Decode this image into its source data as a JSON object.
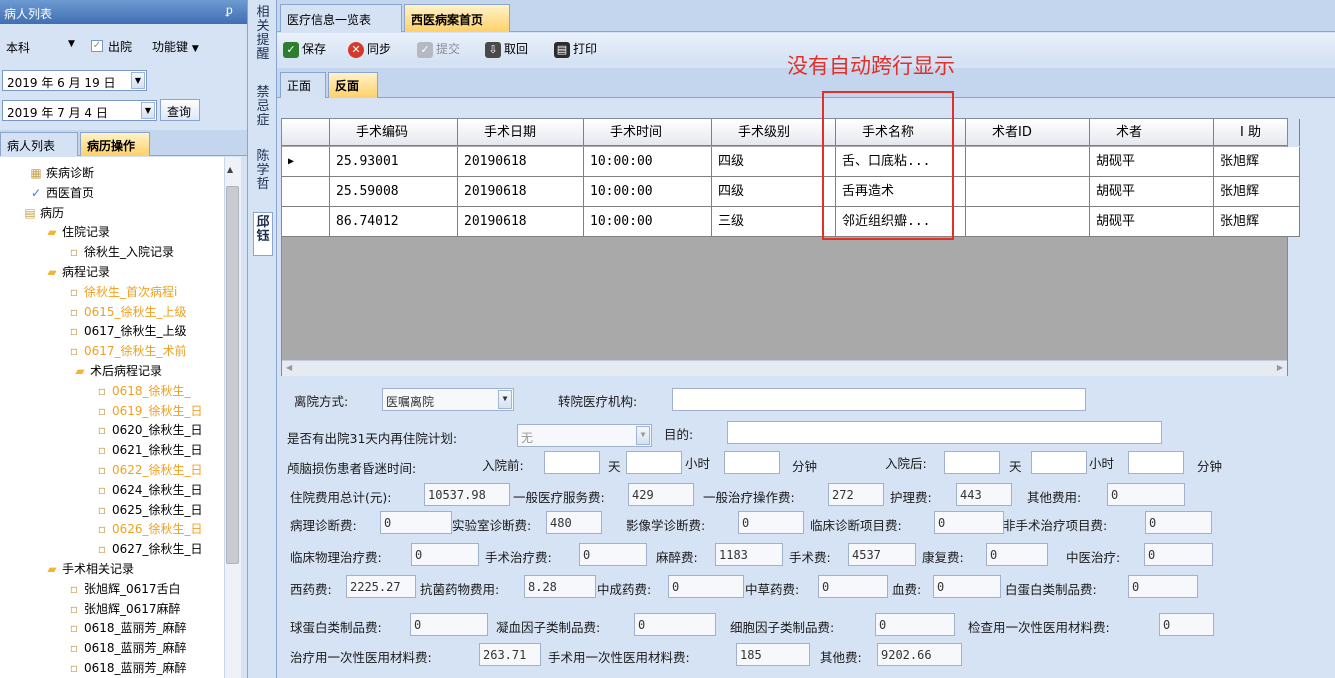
{
  "left_panel": {
    "title": "病人列表",
    "pin_icon": "pin-icon",
    "dept": "本科",
    "discharge_label": "出院",
    "function_key": "功能键",
    "date_from": "2019 年 6 月 19 日",
    "date_to": "2019 年 7 月 4 日",
    "query": "查询",
    "tabs": [
      "病人列表",
      "病历操作"
    ],
    "tree": [
      {
        "label": "疾病诊断",
        "style": "n"
      },
      {
        "label": "西医首页",
        "style": "n"
      },
      {
        "label": "病历",
        "style": "n"
      },
      {
        "label": "住院记录",
        "style": "n"
      },
      {
        "label": "徐秋生_入院记录",
        "style": "n"
      },
      {
        "label": "病程记录",
        "style": "n"
      },
      {
        "label": "徐秋生_首次病程i",
        "style": "o"
      },
      {
        "label": "0615_徐秋生_上级",
        "style": "o"
      },
      {
        "label": "0617_徐秋生_上级",
        "style": "n"
      },
      {
        "label": "0617_徐秋生_术前",
        "style": "o"
      },
      {
        "label": "术后病程记录",
        "style": "n"
      },
      {
        "label": "0618_徐秋生_",
        "style": "o"
      },
      {
        "label": "0619_徐秋生_日",
        "style": "o"
      },
      {
        "label": "0620_徐秋生_日",
        "style": "n"
      },
      {
        "label": "0621_徐秋生_日",
        "style": "n"
      },
      {
        "label": "0622_徐秋生_日",
        "style": "o"
      },
      {
        "label": "0624_徐秋生_日",
        "style": "n"
      },
      {
        "label": "0625_徐秋生_日",
        "style": "n"
      },
      {
        "label": "0626_徐秋生_日",
        "style": "o"
      },
      {
        "label": "0627_徐秋生_日",
        "style": "n"
      },
      {
        "label": "手术相关记录",
        "style": "n"
      },
      {
        "label": "张旭辉_0617舌白",
        "style": "n"
      },
      {
        "label": "张旭辉_0617麻醉",
        "style": "n"
      },
      {
        "label": "0618_蓝丽芳_麻醉",
        "style": "n"
      },
      {
        "label": "0618_蓝丽芳_麻醉",
        "style": "n"
      },
      {
        "label": "0618_蓝丽芳_麻醉",
        "style": "n"
      }
    ]
  },
  "side_tabs": [
    "相关提醒",
    "禁忌症",
    "陈学哲",
    "邱钰"
  ],
  "doc_tabs": [
    "医疗信息一览表",
    "西医病案首页"
  ],
  "toolbar": {
    "save": "保存",
    "sync": "同步",
    "submit": "提交",
    "fetch": "取回",
    "print": "打印"
  },
  "sub_tabs": [
    "正面",
    "反面"
  ],
  "annotation": "没有自动跨行显示",
  "grid": {
    "columns": [
      "手术编码",
      "手术日期",
      "手术时间",
      "手术级别",
      "手术名称",
      "术者ID",
      "术者",
      "I 助"
    ],
    "rows": [
      [
        "25.93001",
        "20190618",
        "10:00:00",
        "四级",
        "舌、口底粘...",
        "",
        "胡砚平",
        "张旭辉"
      ],
      [
        "25.59008",
        "20190618",
        "10:00:00",
        "四级",
        "舌再造术",
        "",
        "胡砚平",
        "张旭辉"
      ],
      [
        "86.74012",
        "20190618",
        "10:00:00",
        "三级",
        "邻近组织瓣...",
        "",
        "胡砚平",
        "张旭辉"
      ]
    ]
  },
  "form": {
    "discharge_method_label": "离院方式:",
    "discharge_method": "医嘱离院",
    "transfer_org_label": "转院医疗机构:",
    "readmit_label": "是否有出院31天内再住院计划:",
    "readmit": "无",
    "purpose_label": "目的:",
    "coma_label": "颅脑损伤患者昏迷时间:",
    "before_label": "入院前:",
    "after_label": "入院后:",
    "day": "天",
    "hour": "小时",
    "minute": "分钟",
    "total_label": "住院费用总计(元):",
    "total": "10537.98",
    "general_service_label": "一般医疗服务费:",
    "general_service": "429",
    "general_treatment_label": "一般治疗操作费:",
    "general_treatment": "272",
    "nursing_label": "护理费:",
    "nursing": "443",
    "other_fee_label": "其他费用:",
    "other_fee": "0",
    "pathology_label": "病理诊断费:",
    "pathology": "0",
    "lab_label": "实验室诊断费:",
    "lab": "480",
    "imaging_label": "影像学诊断费:",
    "imaging": "0",
    "clinical_dx_label": "临床诊断项目费:",
    "clinical_dx": "0",
    "nonsurg_label": "非手术治疗项目费:",
    "nonsurg": "0",
    "physio_label": "临床物理治疗费:",
    "physio": "0",
    "surg_treat_label": "手术治疗费:",
    "surg_treat": "0",
    "anesth_label": "麻醉费:",
    "anesth": "1183",
    "surgery_label": "手术费:",
    "surgery": "4537",
    "rehab_label": "康复费:",
    "rehab": "0",
    "tcm_label": "中医治疗:",
    "tcm": "0",
    "western_label": "西药费:",
    "western": "2225.27",
    "antibiotic_label": "抗菌药物费用:",
    "antibiotic": "8.28",
    "cpm_label": "中成药费:",
    "cpm": "0",
    "herbal_label": "中草药费:",
    "herbal": "0",
    "blood_label": "血费:",
    "blood": "0",
    "albumin_label": "白蛋白类制品费:",
    "albumin": "0",
    "globulin_label": "球蛋白类制品费:",
    "globulin": "0",
    "coag_label": "凝血因子类制品费:",
    "coag": "0",
    "cytokine_label": "细胞因子类制品费:",
    "cytokine": "0",
    "exam_disp_label": "检查用一次性医用材料费:",
    "exam_disp": "0",
    "treat_disp_label": "治疗用一次性医用材料费:",
    "treat_disp": "263.71",
    "surg_disp_label": "手术用一次性医用材料费:",
    "surg_disp": "185",
    "others_label": "其他费:",
    "others": "9202.66"
  }
}
